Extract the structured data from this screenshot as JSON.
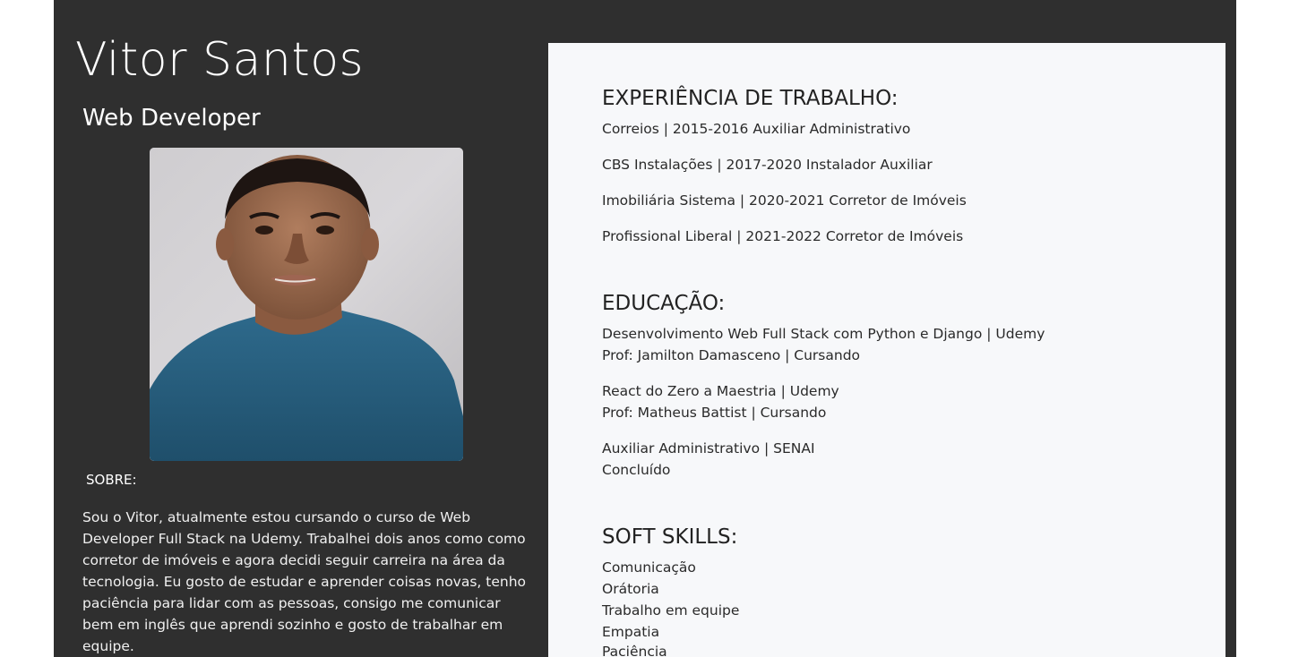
{
  "profile": {
    "name": "Vitor Santos",
    "role": "Web Developer",
    "photo_description_icon": "portrait-photo"
  },
  "about": {
    "label": "SOBRE:",
    "text": "Sou o Vitor, atualmente estou cursando o curso de Web Developer Full Stack na Udemy. Trabalhei dois anos como como corretor de imóveis e agora decidi seguir carreira na área da tecnologia. Eu gosto de estudar e aprender coisas novas, tenho paciência para lidar com as pessoas, consigo me comunicar bem em inglês que aprendi sozinho e gosto de trabalhar em equipe."
  },
  "experience": {
    "title": "EXPERIÊNCIA DE TRABALHO:",
    "items": [
      "Correios | 2015-2016 Auxiliar Administrativo",
      "CBS Instalações | 2017-2020 Instalador Auxiliar",
      "Imobiliária Sistema | 2020-2021 Corretor de Imóveis",
      "Profissional Liberal | 2021-2022 Corretor de Imóveis"
    ]
  },
  "education": {
    "title": "EDUCAÇÃO:",
    "items": [
      {
        "line1": "Desenvolvimento Web Full Stack com Python e Django | Udemy",
        "line2": "Prof: Jamilton Damasceno | Cursando"
      },
      {
        "line1": "React do Zero a Maestria | Udemy",
        "line2": "Prof: Matheus Battist | Cursando"
      },
      {
        "line1": "Auxiliar Administrativo | SENAI",
        "line2": "Concluído"
      }
    ]
  },
  "soft_skills": {
    "title": "SOFT SKILLS:",
    "items": [
      "Comunicação",
      "Orátoria",
      "Trabalho em equipe",
      "Empatia",
      "Paciência"
    ]
  },
  "colors": {
    "page_background": "#ffffff",
    "sidebar_background": "#2f2f2f",
    "main_background": "#f7f8fa",
    "shirt": "#2a5f7f"
  }
}
